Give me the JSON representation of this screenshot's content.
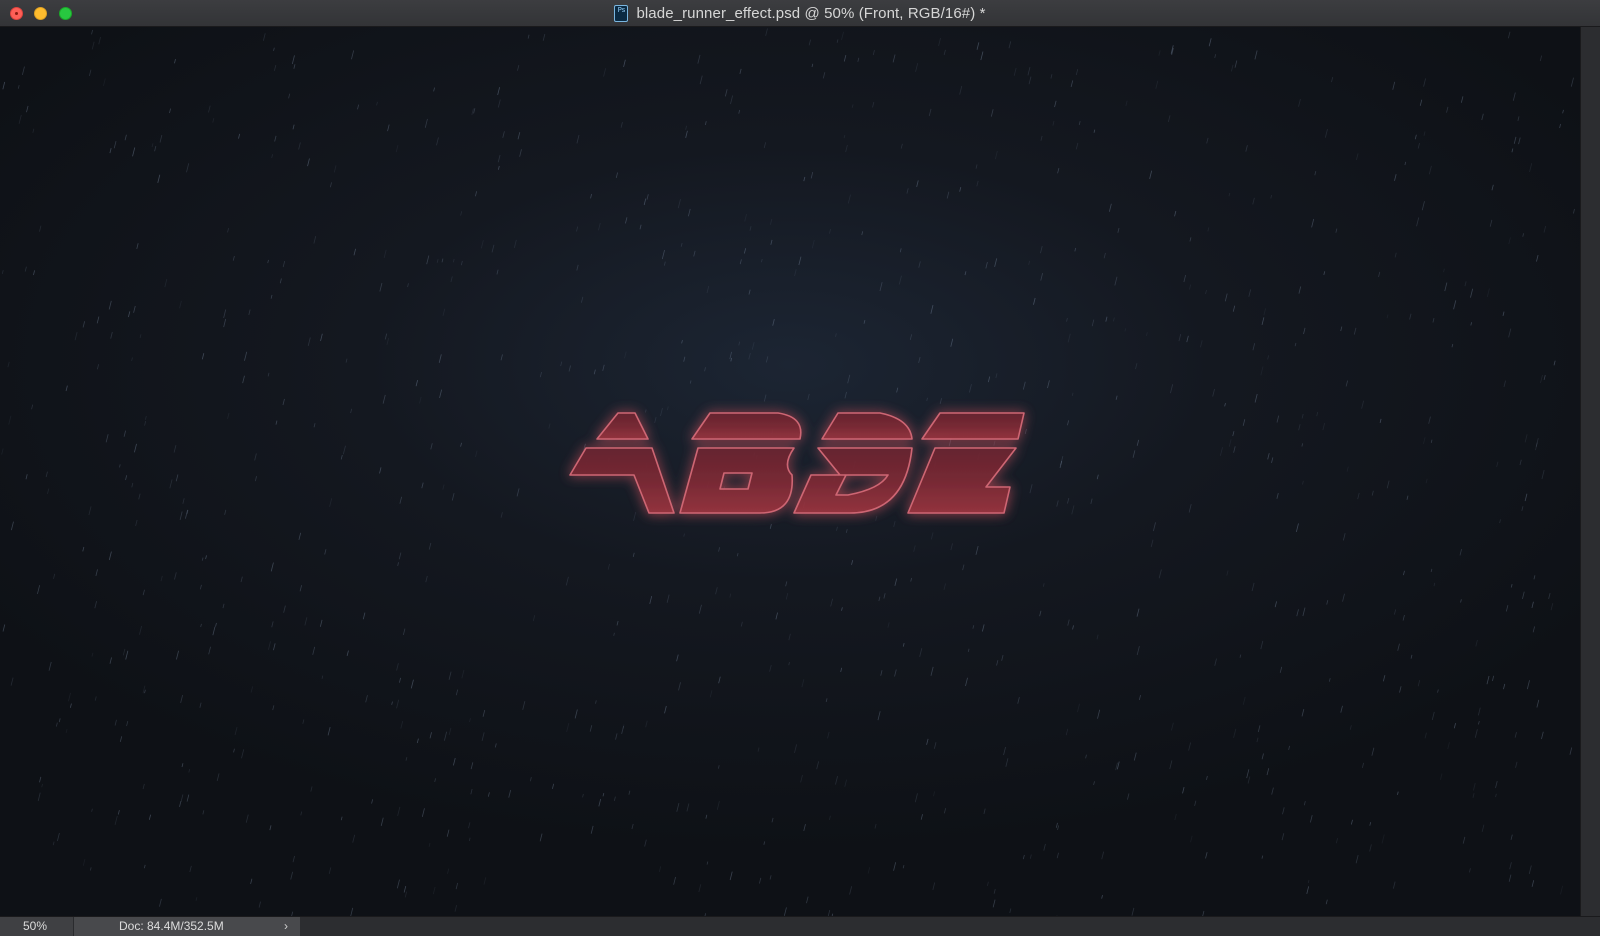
{
  "window": {
    "title": "blade_runner_effect.psd @ 50% (Front, RGB/16#) *",
    "app_icon": "ps-icon",
    "app_icon_label": "Ps"
  },
  "canvas": {
    "artwork_text": "ABDZ",
    "artwork_color": "#9b3a48",
    "background_color": "#10141b"
  },
  "status": {
    "zoom": "50%",
    "doc_info": "Doc: 84.4M/352.5M",
    "arrow": "›"
  }
}
